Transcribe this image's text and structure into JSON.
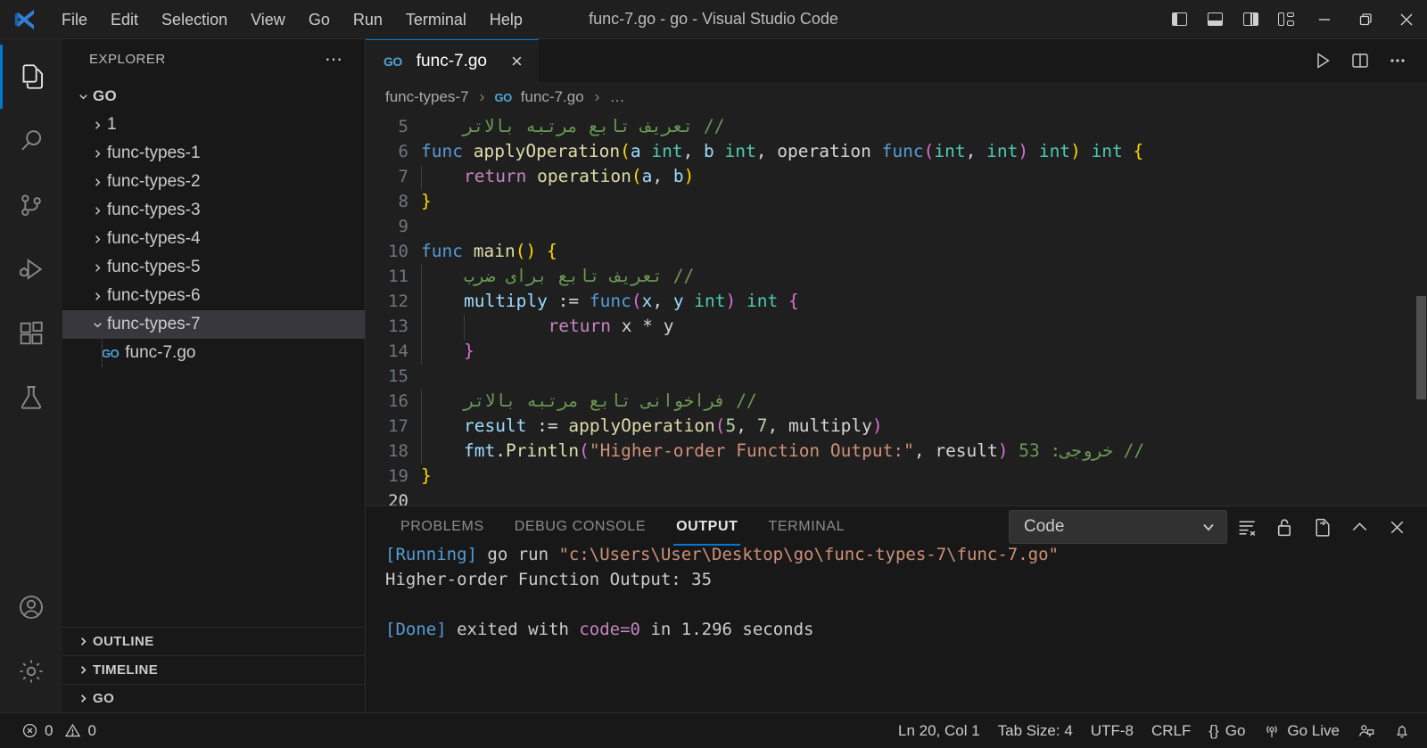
{
  "window": {
    "title": "func-7.go - go - Visual Studio Code",
    "menus": [
      "File",
      "Edit",
      "Selection",
      "View",
      "Go",
      "Run",
      "Terminal",
      "Help"
    ],
    "layout_buttons": [
      "toggle-primary-sidebar",
      "toggle-panel",
      "toggle-secondary-sidebar",
      "customize-layout"
    ],
    "controls": [
      "minimize",
      "restore",
      "close"
    ]
  },
  "activitybar": {
    "items": [
      {
        "name": "explorer",
        "icon": "files-icon",
        "active": true
      },
      {
        "name": "search",
        "icon": "search-icon",
        "active": false
      },
      {
        "name": "source-control",
        "icon": "source-control-icon",
        "active": false
      },
      {
        "name": "run-and-debug",
        "icon": "run-debug-icon",
        "active": false
      },
      {
        "name": "extensions",
        "icon": "extensions-icon",
        "active": false
      },
      {
        "name": "testing",
        "icon": "beaker-icon",
        "active": false
      }
    ],
    "bottom": [
      {
        "name": "accounts",
        "icon": "account-icon"
      },
      {
        "name": "manage",
        "icon": "gear-icon"
      }
    ]
  },
  "sidebar": {
    "title": "EXPLORER",
    "more_label": "⋯",
    "root": "GO",
    "folders": [
      "1",
      "func-types-1",
      "func-types-2",
      "func-types-3",
      "func-types-4",
      "func-types-5",
      "func-types-6"
    ],
    "expanded_folder": "func-types-7",
    "file": "func-7.go",
    "file_icon_label": "GO",
    "sections": [
      "OUTLINE",
      "TIMELINE",
      "GO"
    ]
  },
  "editor": {
    "tab": {
      "label": "func-7.go",
      "icon_label": "GO",
      "close": "×"
    },
    "actions": [
      "run-code-button",
      "split-editor-button",
      "more-actions-button"
    ],
    "breadcrumbs": [
      "func-types-7",
      "func-7.go",
      "…"
    ],
    "breadcrumb_icon_label": "GO",
    "first_visible_line": 5,
    "lines": [
      {
        "n": 5,
        "tokens": [
          {
            "t": "    ",
            "c": "plain"
          },
          {
            "t": "// تعریف تابع مرتبه بالاتر",
            "c": "cmt",
            "rtl": true
          }
        ]
      },
      {
        "n": 6,
        "tokens": [
          {
            "t": "func",
            "c": "kw"
          },
          {
            "t": " ",
            "c": "plain"
          },
          {
            "t": "applyOperation",
            "c": "fn"
          },
          {
            "t": "(",
            "c": "brace"
          },
          {
            "t": "a ",
            "c": "param"
          },
          {
            "t": "int",
            "c": "type"
          },
          {
            "t": ", ",
            "c": "plain"
          },
          {
            "t": "b ",
            "c": "param"
          },
          {
            "t": "int",
            "c": "type"
          },
          {
            "t": ", ",
            "c": "plain"
          },
          {
            "t": "operation ",
            "c": "plain"
          },
          {
            "t": "func",
            "c": "kw"
          },
          {
            "t": "(",
            "c": "paren"
          },
          {
            "t": "int",
            "c": "type"
          },
          {
            "t": ", ",
            "c": "plain"
          },
          {
            "t": "int",
            "c": "type"
          },
          {
            "t": ")",
            "c": "paren"
          },
          {
            "t": " ",
            "c": "plain"
          },
          {
            "t": "int",
            "c": "type"
          },
          {
            "t": ")",
            "c": "brace"
          },
          {
            "t": " ",
            "c": "plain"
          },
          {
            "t": "int",
            "c": "type"
          },
          {
            "t": " ",
            "c": "plain"
          },
          {
            "t": "{",
            "c": "brace"
          }
        ]
      },
      {
        "n": 7,
        "tokens": [
          {
            "t": "    ",
            "c": "plain"
          },
          {
            "t": "return",
            "c": "kw2"
          },
          {
            "t": " ",
            "c": "plain"
          },
          {
            "t": "operation",
            "c": "fn"
          },
          {
            "t": "(",
            "c": "brace"
          },
          {
            "t": "a",
            "c": "param"
          },
          {
            "t": ", ",
            "c": "plain"
          },
          {
            "t": "b",
            "c": "param"
          },
          {
            "t": ")",
            "c": "brace"
          }
        ]
      },
      {
        "n": 8,
        "tokens": [
          {
            "t": "}",
            "c": "brace"
          }
        ]
      },
      {
        "n": 9,
        "tokens": []
      },
      {
        "n": 10,
        "tokens": [
          {
            "t": "func",
            "c": "kw"
          },
          {
            "t": " ",
            "c": "plain"
          },
          {
            "t": "main",
            "c": "fn"
          },
          {
            "t": "(",
            "c": "brace"
          },
          {
            "t": ")",
            "c": "brace"
          },
          {
            "t": " ",
            "c": "plain"
          },
          {
            "t": "{",
            "c": "brace"
          }
        ]
      },
      {
        "n": 11,
        "tokens": [
          {
            "t": "    ",
            "c": "plain"
          },
          {
            "t": "// تعریف تابع برای ضرب",
            "c": "cmt",
            "rtl": true
          }
        ]
      },
      {
        "n": 12,
        "tokens": [
          {
            "t": "    ",
            "c": "plain"
          },
          {
            "t": "multiply",
            "c": "var"
          },
          {
            "t": " := ",
            "c": "plain"
          },
          {
            "t": "func",
            "c": "kw"
          },
          {
            "t": "(",
            "c": "brace2"
          },
          {
            "t": "x",
            "c": "param"
          },
          {
            "t": ", ",
            "c": "plain"
          },
          {
            "t": "y ",
            "c": "param"
          },
          {
            "t": "int",
            "c": "type"
          },
          {
            "t": ")",
            "c": "brace2"
          },
          {
            "t": " ",
            "c": "plain"
          },
          {
            "t": "int",
            "c": "type"
          },
          {
            "t": " ",
            "c": "plain"
          },
          {
            "t": "{",
            "c": "brace2"
          }
        ]
      },
      {
        "n": 13,
        "tokens": [
          {
            "t": "        ",
            "c": "plain"
          },
          {
            "t": "return",
            "c": "kw2"
          },
          {
            "t": " ",
            "c": "plain"
          },
          {
            "t": "x ",
            "c": "plain"
          },
          {
            "t": "* ",
            "c": "plain"
          },
          {
            "t": "y",
            "c": "plain"
          }
        ]
      },
      {
        "n": 14,
        "tokens": [
          {
            "t": "    ",
            "c": "plain"
          },
          {
            "t": "}",
            "c": "brace2"
          }
        ]
      },
      {
        "n": 15,
        "tokens": []
      },
      {
        "n": 16,
        "tokens": [
          {
            "t": "    ",
            "c": "plain"
          },
          {
            "t": "// فراخوانی تابع مرتبه بالاتر",
            "c": "cmt",
            "rtl": true
          }
        ]
      },
      {
        "n": 17,
        "tokens": [
          {
            "t": "    ",
            "c": "plain"
          },
          {
            "t": "result",
            "c": "var"
          },
          {
            "t": " := ",
            "c": "plain"
          },
          {
            "t": "applyOperation",
            "c": "fn"
          },
          {
            "t": "(",
            "c": "brace2"
          },
          {
            "t": "5",
            "c": "num"
          },
          {
            "t": ", ",
            "c": "plain"
          },
          {
            "t": "7",
            "c": "num"
          },
          {
            "t": ", ",
            "c": "plain"
          },
          {
            "t": "multiply",
            "c": "plain"
          },
          {
            "t": ")",
            "c": "brace2"
          }
        ]
      },
      {
        "n": 18,
        "tokens": [
          {
            "t": "    ",
            "c": "plain"
          },
          {
            "t": "fmt",
            "c": "var"
          },
          {
            "t": ".",
            "c": "plain"
          },
          {
            "t": "Println",
            "c": "fn"
          },
          {
            "t": "(",
            "c": "brace2"
          },
          {
            "t": "\"Higher-order Function Output:\"",
            "c": "str"
          },
          {
            "t": ", ",
            "c": "plain"
          },
          {
            "t": "result",
            "c": "plain"
          },
          {
            "t": ")",
            "c": "brace2"
          },
          {
            "t": " ",
            "c": "plain"
          },
          {
            "t": "// خروجی: 35",
            "c": "cmt",
            "rtl": true
          }
        ]
      },
      {
        "n": 19,
        "tokens": [
          {
            "t": "}",
            "c": "brace"
          }
        ]
      },
      {
        "n": 20,
        "tokens": []
      }
    ]
  },
  "panel": {
    "tabs": [
      {
        "label": "PROBLEMS",
        "active": false
      },
      {
        "label": "DEBUG CONSOLE",
        "active": false
      },
      {
        "label": "OUTPUT",
        "active": true
      },
      {
        "label": "TERMINAL",
        "active": false
      }
    ],
    "channel_select": "Code",
    "actions": [
      "clear-output-button",
      "lock-scroll-button",
      "open-in-editor-button",
      "maximize-panel-button",
      "close-panel-button"
    ],
    "output_lines": [
      {
        "segments": [
          {
            "t": "[Running] ",
            "c": "run"
          },
          {
            "t": "go run ",
            "c": "plain"
          },
          {
            "t": "\"c:\\Users\\User\\Desktop\\go\\func-types-7\\func-7.go\"",
            "c": "path"
          }
        ]
      },
      {
        "segments": [
          {
            "t": "Higher-order Function Output: 35",
            "c": "plain"
          }
        ]
      },
      {
        "segments": []
      },
      {
        "segments": [
          {
            "t": "[Done] ",
            "c": "done"
          },
          {
            "t": "exited with ",
            "c": "plain"
          },
          {
            "t": "code=0",
            "c": "code"
          },
          {
            "t": " in 1.296 seconds",
            "c": "plain"
          }
        ]
      }
    ]
  },
  "statusbar": {
    "errors": "0",
    "warnings": "0",
    "position": "Ln 20, Col 1",
    "tab_size": "Tab Size: 4",
    "encoding": "UTF-8",
    "eol": "CRLF",
    "language": "Go",
    "language_prefix": "{}",
    "go_live": "Go Live",
    "icons": [
      "error-icon",
      "warning-icon",
      "broadcast-icon",
      "feedback-icon",
      "bell-icon"
    ]
  },
  "colors": {
    "accent": "#0078d4",
    "titlebar_bg": "#1f1f1f",
    "sidebar_bg": "#181818",
    "editor_bg": "#1f1f1f",
    "selection_bg": "#37373d",
    "comment": "#6a9955",
    "keyword": "#569cd6",
    "string": "#ce9178",
    "function": "#dcdcaa",
    "type": "#4ec9b0",
    "number": "#b5cea8"
  }
}
